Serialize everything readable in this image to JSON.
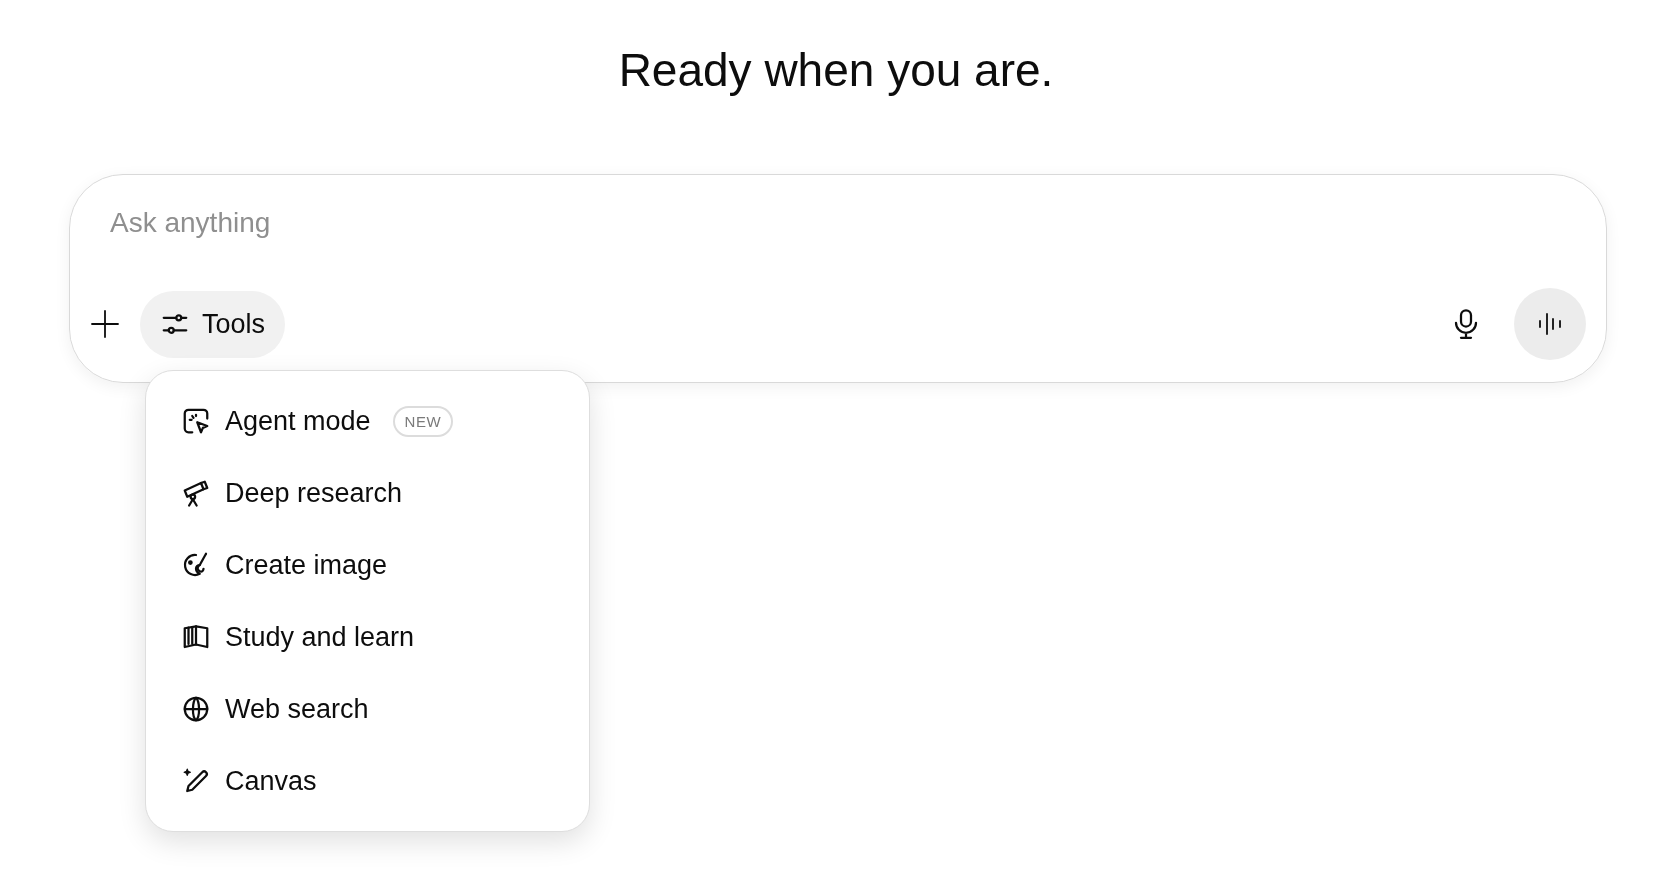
{
  "heading": "Ready when you are.",
  "composer": {
    "placeholder": "Ask anything",
    "tools_button": {
      "label": "Tools",
      "selected": true
    }
  },
  "tools_menu": {
    "items": [
      {
        "label": "Agent mode",
        "badge": "NEW"
      },
      {
        "label": "Deep research"
      },
      {
        "label": "Create image"
      },
      {
        "label": "Study and learn"
      },
      {
        "label": "Web search"
      },
      {
        "label": "Canvas"
      }
    ]
  }
}
